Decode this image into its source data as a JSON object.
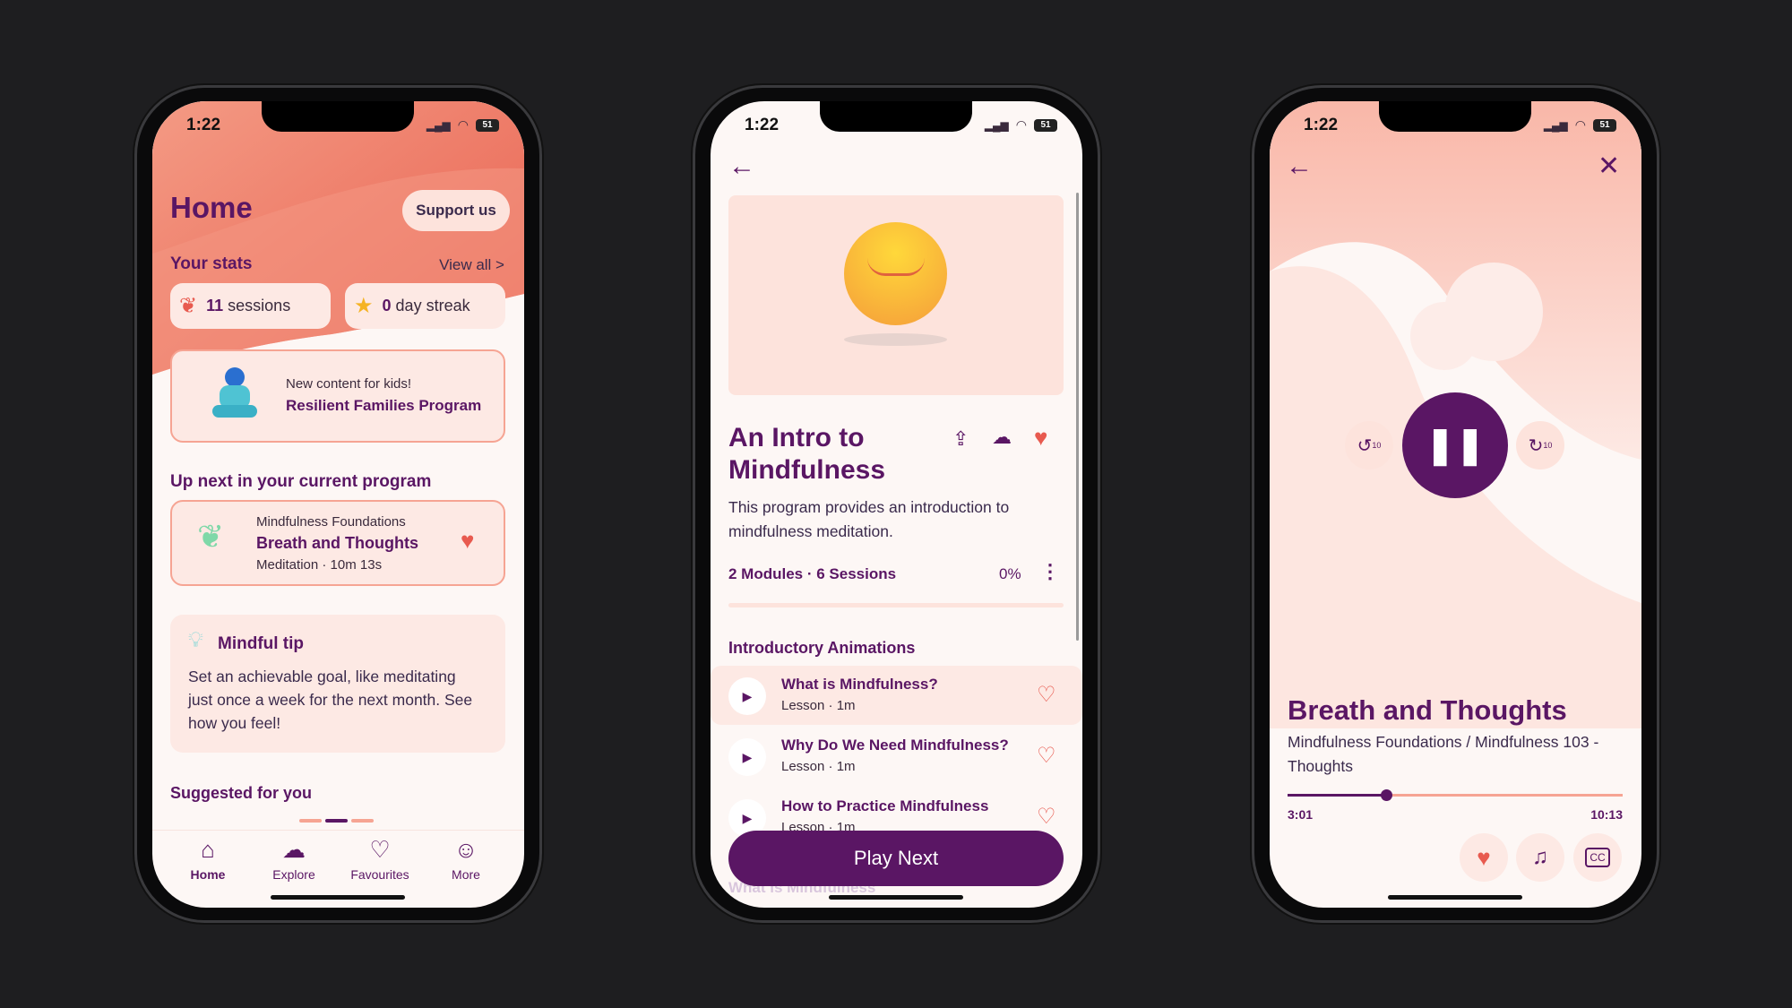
{
  "status_bar": {
    "time": "1:22",
    "battery": "51"
  },
  "home": {
    "title": "Home",
    "support_button": "Support us",
    "stats_heading": "Your stats",
    "view_all": "View all >",
    "sessions_count": "11",
    "sessions_label": "sessions",
    "streak_count": "0",
    "streak_label": "day streak",
    "kids_banner": {
      "line1": "New content for kids!",
      "line2": "Resilient Families Program"
    },
    "up_next_heading": "Up next in your current program",
    "up_next": {
      "program": "Mindfulness Foundations",
      "title": "Breath and Thoughts",
      "meta": "Meditation · 10m 13s",
      "favourited": true
    },
    "tip": {
      "title": "Mindful tip",
      "text": "Set an achievable goal, like meditating just once a week for the next month. See how you feel!"
    },
    "suggested_heading": "Suggested for you",
    "carousel": {
      "pages": 3,
      "active": 2
    },
    "tabs": [
      {
        "label": "Home",
        "icon": "home-icon",
        "active": true
      },
      {
        "label": "Explore",
        "icon": "cloud-icon"
      },
      {
        "label": "Favourites",
        "icon": "heart-icon"
      },
      {
        "label": "More",
        "icon": "smile-icon"
      }
    ]
  },
  "program": {
    "title_line1": "An Intro to",
    "title_line2": "Mindfulness",
    "description": "This program provides an introduction to mindfulness meditation.",
    "summary": "2 Modules · 6 Sessions",
    "progress": "0%",
    "progress_value": 0,
    "section_heading": "Introductory Animations",
    "lessons": [
      {
        "title": "What is Mindfulness?",
        "meta": "Lesson · 1m"
      },
      {
        "title": "Why Do We Need Mindfulness?",
        "meta": "Lesson · 1m"
      },
      {
        "title": "How to Practice Mindfulness",
        "meta": "Lesson · 1m"
      }
    ],
    "play_next": "Play Next",
    "faded_text": "What is Mindfulness"
  },
  "player": {
    "title": "Breath and Thoughts",
    "subtitle": "Mindfulness Foundations / Mindfulness 103 - Thoughts",
    "elapsed": "3:01",
    "duration": "10:13",
    "progress_fraction": 0.295,
    "rewind_label": "10",
    "forward_label": "10"
  },
  "colors": {
    "purple": "#5a1664",
    "coral": "#e85a4f",
    "card": "#fde9e4",
    "card_border": "#f6a493",
    "background": "#fdf7f5"
  }
}
